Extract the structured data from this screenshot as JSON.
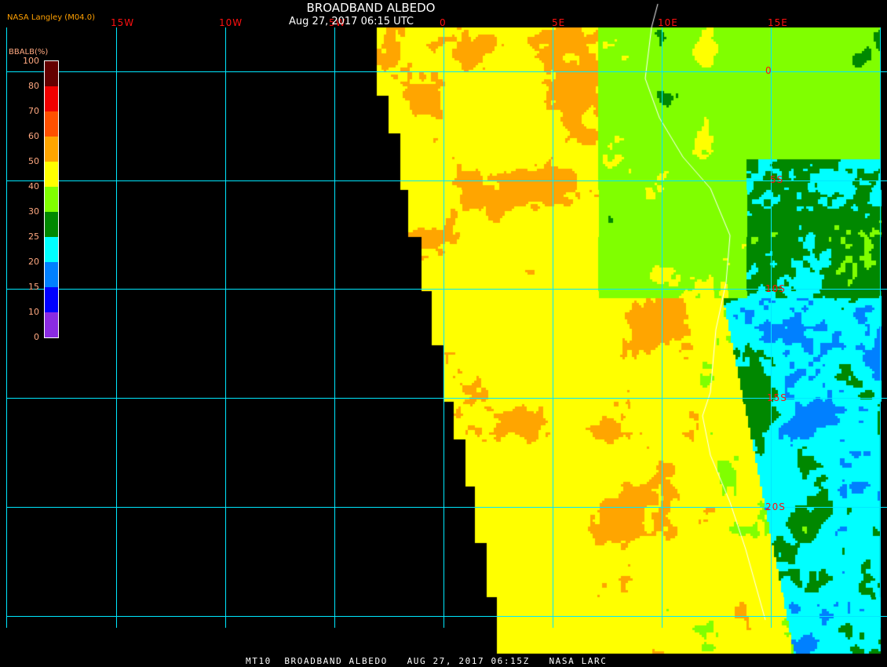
{
  "header": {
    "title": "BROADBAND ALBEDO",
    "subtitle": "Aug 27, 2017 06:15 UTC",
    "credit": "NASA Langley (M04.0)"
  },
  "footer": {
    "text": "MT10  BROADBAND ALBEDO   AUG 27, 2017 06:15Z   NASA LARC"
  },
  "legend": {
    "title": "BBALB(%)",
    "ticks": [
      "0",
      "10",
      "15",
      "20",
      "25",
      "30",
      "40",
      "50",
      "60",
      "70",
      "80",
      "100"
    ],
    "colors": [
      "#8a2be2",
      "#0000ff",
      "#0080ff",
      "#00ffff",
      "#008800",
      "#80ff00",
      "#ffff00",
      "#ffa500",
      "#ff5000",
      "#f00000",
      "#640000"
    ]
  },
  "grid": {
    "longitudes": [
      "15W",
      "10W",
      "5W",
      "0",
      "5E",
      "10E",
      "15E"
    ],
    "latitudes": [
      "0",
      "5S",
      "10S",
      "15S",
      "20S"
    ],
    "line_color": "#00e8ff",
    "label_color": "#ff1010"
  }
}
